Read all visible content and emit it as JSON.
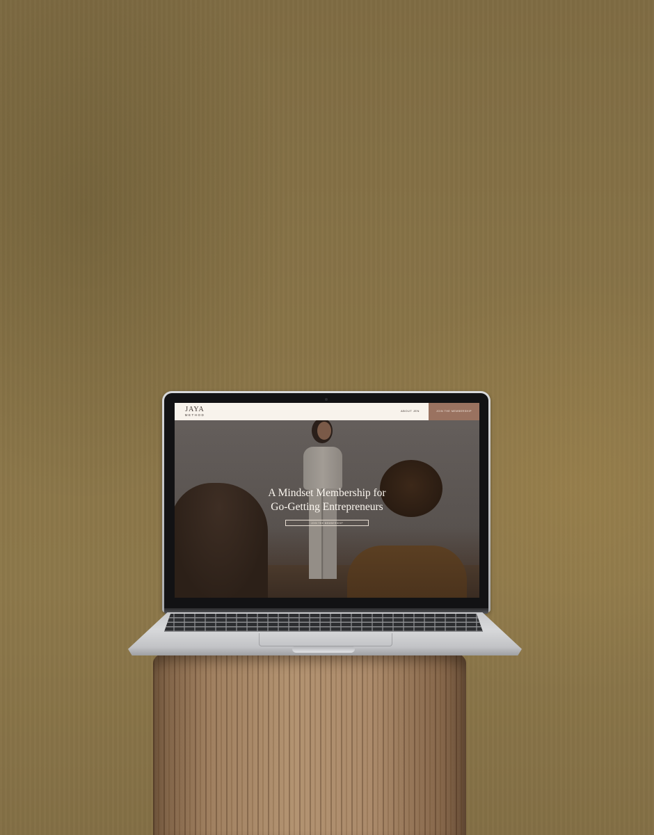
{
  "website": {
    "logo_main": "JAYA",
    "logo_sub": "METHOD",
    "nav": {
      "about_label": "ABOUT JEN",
      "join_label": "JOIN THE MEMBERSHIP"
    },
    "hero": {
      "title_line1": "A Mindset Membership for",
      "title_line2": "Go-Getting Entrepreneurs",
      "button_label": "JOIN THE MEMBERSHIP"
    }
  },
  "colors": {
    "wall": "#8a7548",
    "header_bg": "#f8f3ec",
    "accent_button": "#9a7260",
    "hero_text": "#fbf6ef"
  }
}
